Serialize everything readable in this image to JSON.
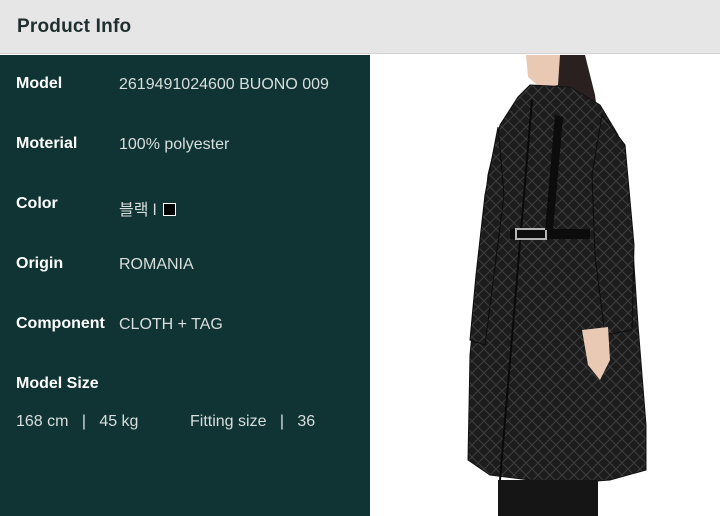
{
  "header": {
    "title": "Product Info"
  },
  "details": [
    {
      "label": "Model",
      "value": "2619491024600 BUONO 009"
    },
    {
      "label": "Moterial",
      "value": "100% polyester"
    },
    {
      "label": "Color",
      "value": "블랙 l"
    },
    {
      "label": "Origin",
      "value": "ROMANIA"
    },
    {
      "label": "Component",
      "value": "CLOTH + TAG"
    }
  ],
  "model_size": {
    "label": "Model Size",
    "height": "168 cm",
    "separator": "|",
    "weight": "45 kg",
    "fitting_label": "Fitting size",
    "fitting_value": "36"
  },
  "colors": {
    "panel_bg": "#0f3433",
    "header_bg": "#e6e6e6",
    "swatch": "#000000"
  }
}
